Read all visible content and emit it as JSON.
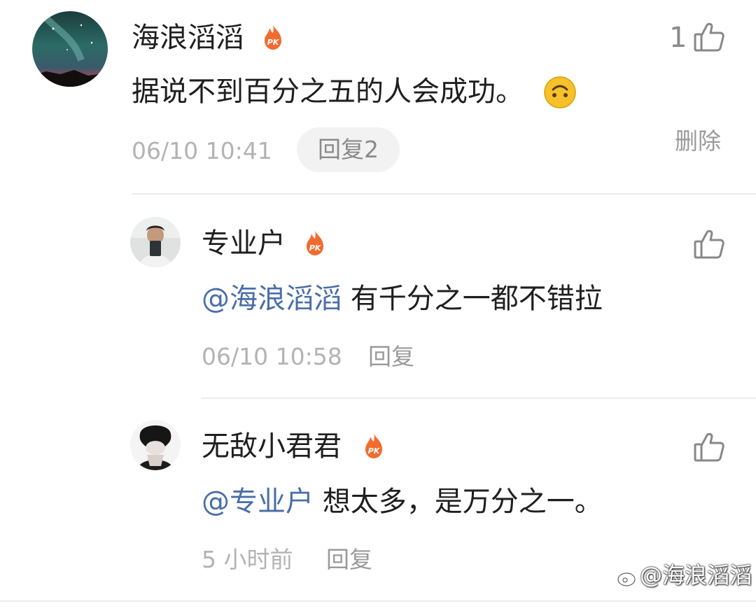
{
  "comments": [
    {
      "name": "海浪滔滔",
      "text": "据说不到百分之五的人会成功。",
      "emoji_icon": "upside-down-smile-emoji",
      "time": "06/10 10:41",
      "reply_label": "回复2",
      "delete_label": "删除",
      "like_count": "1"
    }
  ],
  "replies": [
    {
      "name": "专业户",
      "mention": "@海浪滔滔",
      "text": " 有千分之一都不错拉",
      "time": "06/10 10:58",
      "reply_label": "回复"
    },
    {
      "name": "无敌小君君",
      "mention": "@专业户",
      "text": " 想太多，是万分之一。",
      "time": "5 小时前",
      "reply_label": "回复"
    }
  ],
  "watermark": "@海浪滔滔",
  "colors": {
    "mention": "#4a6ea8",
    "badge": "#f26b2e",
    "meta": "#b3b3b3"
  }
}
